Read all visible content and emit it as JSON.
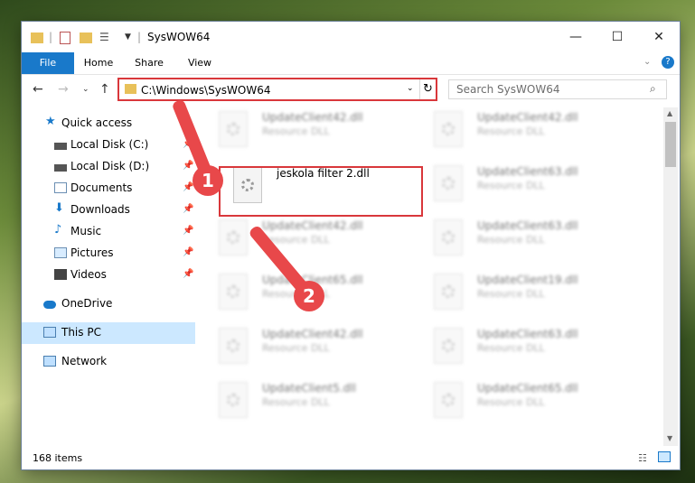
{
  "window": {
    "title": "SysWOW64"
  },
  "ribbon": {
    "tabs": [
      "File",
      "Home",
      "Share",
      "View"
    ]
  },
  "nav": {
    "address": "C:\\Windows\\SysWOW64",
    "search_placeholder": "Search SysWOW64"
  },
  "sidebar": {
    "items": [
      {
        "label": "Quick access"
      },
      {
        "label": "Local Disk (C:)"
      },
      {
        "label": "Local Disk (D:)"
      },
      {
        "label": "Documents"
      },
      {
        "label": "Downloads"
      },
      {
        "label": "Music"
      },
      {
        "label": "Pictures"
      },
      {
        "label": "Videos"
      },
      {
        "label": "OneDrive"
      },
      {
        "label": "This PC"
      },
      {
        "label": "Network"
      }
    ]
  },
  "files": [
    {
      "name": "UpdateClient42.dll",
      "type": "Resource DLL"
    },
    {
      "name": "UpdateClient42.dll",
      "type": "Resource DLL"
    },
    {
      "name": "jeskola filter 2.dll",
      "type": ""
    },
    {
      "name": "UpdateClient63.dll",
      "type": "Resource DLL"
    },
    {
      "name": "UpdateClient42.dll",
      "type": "Resource DLL"
    },
    {
      "name": "UpdateClient63.dll",
      "type": "Resource DLL"
    },
    {
      "name": "UpdateClient65.dll",
      "type": "Resource DLL"
    },
    {
      "name": "UpdateClient19.dll",
      "type": "Resource DLL"
    },
    {
      "name": "UpdateClient42.dll",
      "type": "Resource DLL"
    },
    {
      "name": "UpdateClient63.dll",
      "type": "Resource DLL"
    },
    {
      "name": "UpdateClient5.dll",
      "type": "Resource DLL"
    },
    {
      "name": "UpdateClient65.dll",
      "type": "Resource DLL"
    }
  ],
  "status": {
    "item_count": "168 items"
  },
  "callouts": [
    "1",
    "2"
  ],
  "colors": {
    "accent": "#1979ca",
    "highlight": "#d9373b",
    "selected": "#cce8ff"
  }
}
